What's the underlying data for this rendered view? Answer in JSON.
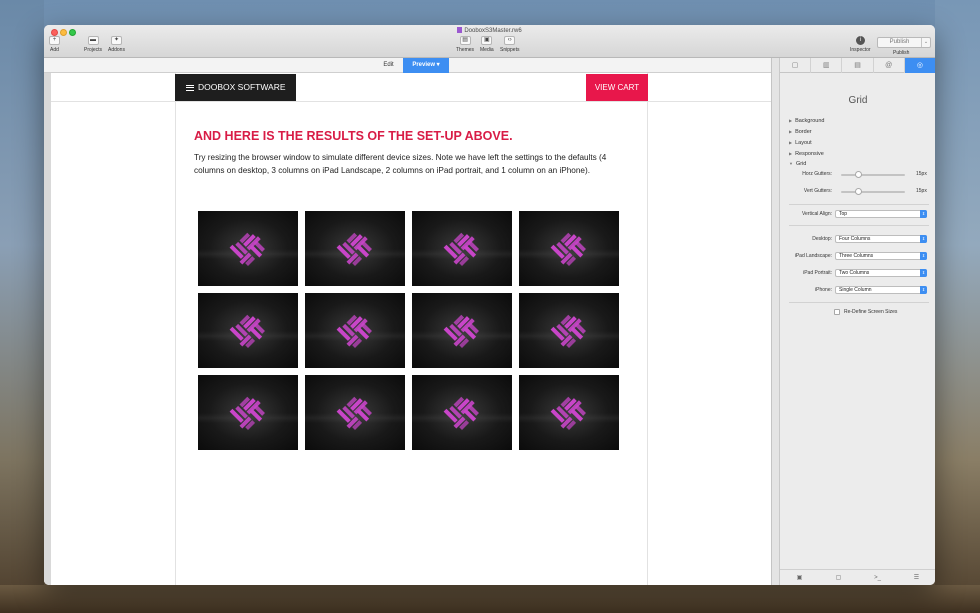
{
  "window": {
    "title": "DooboxS3Master.rw6"
  },
  "toolbar": {
    "add_label": "Add",
    "projects_label": "Projects",
    "addons_label": "Addons",
    "themes_label": "Themes",
    "media_label": "Media",
    "snippets_label": "Snippets",
    "inspector_label": "Inspector",
    "publish_button": "Publish",
    "publish_label": "Publish"
  },
  "modes": {
    "edit": "Edit",
    "preview": "Preview"
  },
  "site": {
    "brand": "DOOBOX SOFTWARE",
    "cart": "VIEW CART",
    "heading": "AND HERE IS THE RESULTS OF THE SET-UP ABOVE.",
    "paragraph": "Try resizing the browser window to simulate different device sizes. Note we have left the settings to the defaults (4 columns on desktop, 3 columns on iPad Landscape, 2 columns on iPad portrait, and 1 column on an iPhone).",
    "tile_count": 12
  },
  "inspector": {
    "title": "Grid",
    "sections": [
      "Background",
      "Border",
      "Layout",
      "Responsive",
      "Grid"
    ],
    "horz_gutters_label": "Horz Gutters:",
    "horz_gutters_value": "15px",
    "vert_gutters_label": "Vert Gutters:",
    "vert_gutters_value": "15px",
    "vertical_align_label": "Vertical Align:",
    "vertical_align_value": "Top",
    "desktop_label": "Desktop:",
    "desktop_value": "Four Columns",
    "ipad_landscape_label": "iPad Landscape:",
    "ipad_landscape_value": "Three Columns",
    "ipad_portrait_label": "iPad Portrait:",
    "ipad_portrait_value": "Two Columns",
    "iphone_label": "iPhone:",
    "iphone_value": "Single Column",
    "redefine_label": "Re-Define Screen Sizes",
    "footer_console": ">_"
  },
  "colors": {
    "accent": "#3d8ef2",
    "brand_red": "#d81c46",
    "cart_red": "#e8174b",
    "tile_logo": "#c845c8"
  }
}
